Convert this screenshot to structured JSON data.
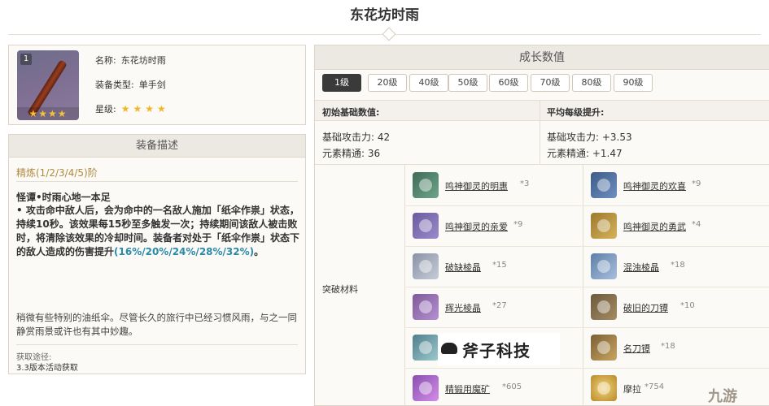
{
  "page": {
    "title": "东花坊时雨"
  },
  "weapon": {
    "rarity_badge": "1",
    "name_label": "名称:",
    "name_value": "东花坊时雨",
    "type_label": "装备类型:",
    "type_value": "单手剑",
    "stars_label": "星级:",
    "stars": "★★★★",
    "thumb_stars": "★★★★"
  },
  "description": {
    "header": "装备描述",
    "refine": "精炼(1/2/3/4/5)阶",
    "passive_title": "怪谭•时雨心地一本足",
    "passive_text_main": "• 攻击命中敌人后，会为命中的一名敌人施加「纸伞作祟」状态，持续10秒。该效果每15秒至多触发一次；持续期间该敌人被击败时，将清除该效果的冷却时间。装备者对处于「纸伞作祟」状态下的敌人造成的伤害提升",
    "passive_text_hl": "(16%/20%/24%/28%/32%)",
    "passive_text_end": "。",
    "lore": "稍微有些特别的油纸伞。尽管长久的旅行中已经习惯风雨，与之一同静赏雨景或许也有其中妙趣。",
    "source_label": "获取途径:",
    "source_value": "3.3版本活动获取"
  },
  "growth": {
    "header": "成长数值",
    "levels": [
      "1级",
      "20级",
      "40级",
      "50级",
      "60级",
      "70级",
      "80级",
      "90级"
    ],
    "active_level": "1级",
    "base_head": "初始基础数值:",
    "avg_head": "平均每级提升:",
    "base_atk": "基础攻击力: 42",
    "base_em": "元素精通: 36",
    "avg_atk": "基础攻击力: +3.53",
    "avg_em": "元素精通: +1.47",
    "materials_label": "突破材料",
    "materials": [
      {
        "name": "鸣神御灵的明惠",
        "count": "*3",
        "icon": "green-gem-icon"
      },
      {
        "name": "鸣神御灵的欢喜",
        "count": "*9",
        "icon": "blue-spiral-icon"
      },
      {
        "name": "鸣神御灵的亲爱",
        "count": "*9",
        "icon": "violet-orb-icon"
      },
      {
        "name": "鸣神御灵的勇武",
        "count": "*4",
        "icon": "gold-emblem-icon"
      },
      {
        "name": "破缺棱晶",
        "count": "*15",
        "icon": "prism-icon"
      },
      {
        "name": "混浊棱晶",
        "count": "*18",
        "icon": "prism-icon"
      },
      {
        "name": "辉光棱晶",
        "count": "*27",
        "icon": "prism-icon"
      },
      {
        "name": "破旧的刀镡",
        "count": "*10",
        "icon": "guard-icon"
      },
      {
        "name": "",
        "count": "",
        "icon": "crystal-icon"
      },
      {
        "name": "名刀镡",
        "count": "*18",
        "icon": "guard-icon"
      },
      {
        "name": "精锻用魔矿",
        "count": "*605",
        "icon": "ore-icon"
      },
      {
        "name": "摩拉",
        "count": "*754",
        "icon": "mora-icon"
      }
    ]
  },
  "watermark": {
    "text": "斧子科技",
    "corner": "九游"
  }
}
